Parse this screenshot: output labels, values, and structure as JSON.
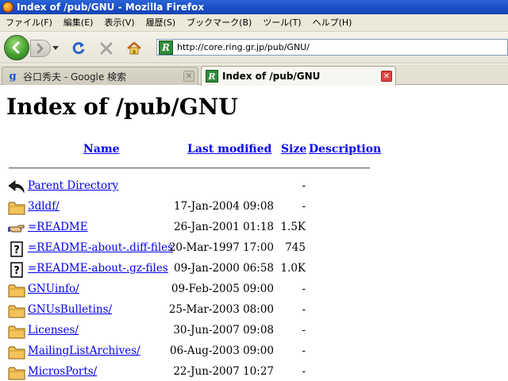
{
  "window": {
    "title": "Index of /pub/GNU - Mozilla Firefox"
  },
  "menu": [
    "ファイル(F)",
    "編集(E)",
    "表示(V)",
    "履歴(S)",
    "ブックマーク(B)",
    "ツール(T)",
    "ヘルプ(H)"
  ],
  "toolbar": {
    "url": "http://core.ring.gr.jp/pub/GNU/"
  },
  "tabs": [
    {
      "label": "谷口秀夫 - Google 検索",
      "active": false,
      "icon": "google-icon"
    },
    {
      "label": "Index of /pub/GNU",
      "active": true,
      "icon": "ring-site-icon"
    }
  ],
  "page": {
    "heading": "Index of /pub/GNU",
    "columns": {
      "name": "Name",
      "modified": "Last modified",
      "size": "Size",
      "description": "Description"
    },
    "entries": [
      {
        "icon": "back-arrow-icon",
        "name": "Parent Directory",
        "modified": "",
        "size": "-"
      },
      {
        "icon": "folder-icon",
        "name": "3dldf/",
        "modified": "17-Jan-2004 09:08",
        "size": "-"
      },
      {
        "icon": "pointing-hand-icon",
        "name": "=README",
        "modified": "26-Jan-2001 01:18",
        "size": "1.5K"
      },
      {
        "icon": "unknown-file-icon",
        "name": "=README-about-.diff-files",
        "modified": "20-Mar-1997 17:00",
        "size": "745"
      },
      {
        "icon": "unknown-file-icon",
        "name": "=README-about-.gz-files",
        "modified": "09-Jan-2000 06:58",
        "size": "1.0K"
      },
      {
        "icon": "folder-icon",
        "name": "GNUinfo/",
        "modified": "09-Feb-2005 09:00",
        "size": "-"
      },
      {
        "icon": "folder-icon",
        "name": "GNUsBulletins/",
        "modified": "25-Mar-2003 08:00",
        "size": "-"
      },
      {
        "icon": "folder-icon",
        "name": "Licenses/",
        "modified": "30-Jun-2007 09:08",
        "size": "-"
      },
      {
        "icon": "folder-icon",
        "name": "MailingListArchives/",
        "modified": "06-Aug-2003 09:00",
        "size": "-"
      },
      {
        "icon": "folder-icon",
        "name": "MicrosPorts/",
        "modified": "22-Jun-2007 10:27",
        "size": "-"
      }
    ]
  }
}
